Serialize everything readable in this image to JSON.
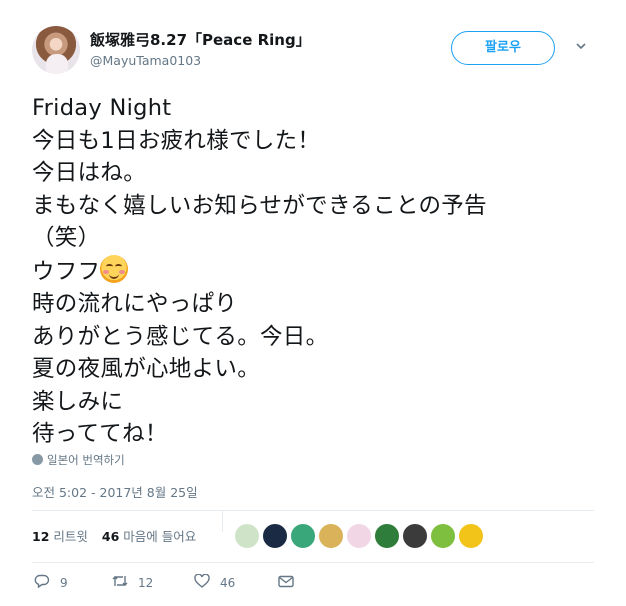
{
  "author": {
    "display_name": "飯塚雅弓8.27「Peace Ring」",
    "handle": "@MayuTama0103"
  },
  "follow_label": "팔로우",
  "tweet_lines": [
    "Friday Night",
    "今日も1日お疲れ様でした！",
    "今日はね。",
    "まもなく嬉しいお知らせができることの予告",
    "（笑）",
    "ウフフ",
    "時の流れにやっぱり",
    "ありがとう感じてる。今日。",
    "夏の夜風が心地よい。",
    "楽しみに",
    "待っててね！"
  ],
  "translate_label": "일본어 번역하기",
  "timestamp": "오전 5:02 - 2017년 8월 25일",
  "stats": {
    "retweets_count": "12",
    "retweets_label": "리트윗",
    "likes_count": "46",
    "likes_label": "마음에 들어요"
  },
  "likers": [
    "#cfe3c9",
    "#1b2a44",
    "#3aa77a",
    "#d9b25a",
    "#f1d7e6",
    "#2f7d3a",
    "#3b3b3b",
    "#7fbf3f",
    "#f2c318"
  ],
  "actions": {
    "reply_count": "9",
    "retweet_count": "12",
    "like_count": "46"
  }
}
